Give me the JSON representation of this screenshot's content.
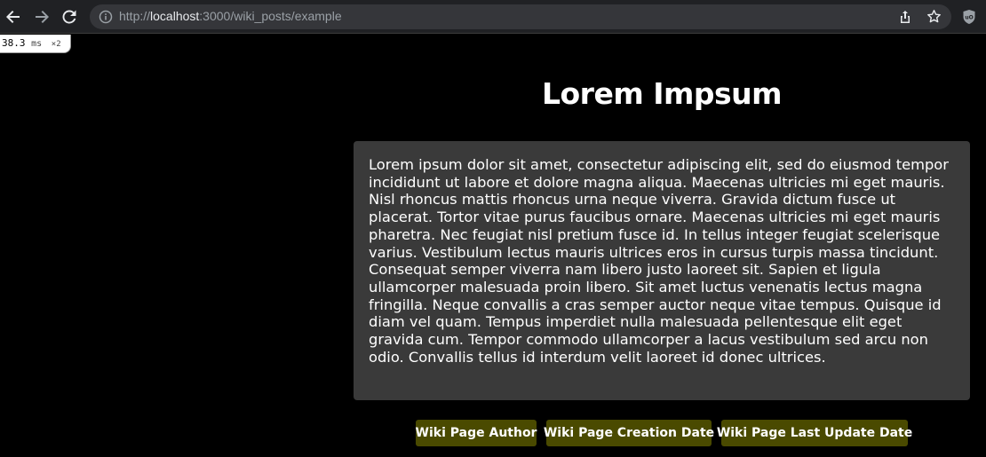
{
  "browser": {
    "url_scheme": "http://",
    "url_host": "localhost",
    "url_rest": ":3000/wiki_posts/example"
  },
  "perf_badge": {
    "value": "38.3",
    "unit": "ms",
    "multiplier": "×2"
  },
  "page": {
    "title": "Lorem Impsum",
    "body": "Lorem ipsum dolor sit amet, consectetur adipiscing elit, sed do eiusmod tempor incididunt ut labore et dolore magna aliqua. Maecenas ultricies mi eget mauris. Nisl rhoncus mattis rhoncus urna neque viverra. Gravida dictum fusce ut placerat. Tortor vitae purus faucibus ornare. Maecenas ultricies mi eget mauris pharetra. Nec feugiat nisl pretium fusce id. In tellus integer feugiat scelerisque varius. Vestibulum lectus mauris ultrices eros in cursus turpis massa tincidunt. Consequat semper viverra nam libero justo laoreet sit. Sapien et ligula ullamcorper malesuada proin libero. Sit amet luctus venenatis lectus magna fringilla. Neque convallis a cras semper auctor neque vitae tempus. Quisque id diam vel quam. Tempus imperdiet nulla malesuada pellentesque elit eget gravida cum. Tempor commodo ullamcorper a lacus vestibulum sed arcu non odio. Convallis tellus id interdum velit laoreet id donec ultrices.",
    "buttons": {
      "author": "Wiki Page Author",
      "created": "Wiki Page Creation Date",
      "updated": "Wiki Page Last Update Date"
    }
  },
  "colors": {
    "page_bg": "#000000",
    "card_bg": "#3a3a3a",
    "button_bg": "#4a4a00",
    "toolbar_bg": "#202124"
  }
}
